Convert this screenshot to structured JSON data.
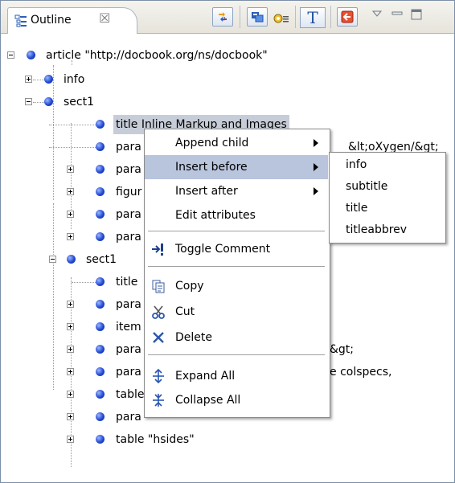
{
  "tab": {
    "title": "Outline",
    "close_glyph": "☒"
  },
  "toolbar": {
    "t_button": "T"
  },
  "tree": [
    {
      "label": "article \"http://docbook.org/ns/docbook\"",
      "expanded": true
    },
    {
      "label": "info"
    },
    {
      "label": "sect1"
    },
    {
      "label": "title  Inline Markup and Images"
    },
    {
      "label": "para",
      "tail": "&lt;oXygen/&gt;"
    },
    {
      "label": "para"
    },
    {
      "label": "figur"
    },
    {
      "label": "para"
    },
    {
      "label": "para"
    },
    {
      "label": "sect1"
    },
    {
      "label": "title"
    },
    {
      "label": "para"
    },
    {
      "label": "item"
    },
    {
      "label": "para",
      "tail": "&gt;"
    },
    {
      "label": "para",
      "tail": "e colspecs,"
    },
    {
      "label": "table"
    },
    {
      "label": "para"
    },
    {
      "label": "table  \"hsides\""
    }
  ],
  "context_menu": {
    "items": [
      {
        "label": "Append child",
        "submenu": true
      },
      {
        "label": "Insert before",
        "submenu": true
      },
      {
        "label": "Insert after",
        "submenu": true
      },
      {
        "label": "Edit attributes"
      },
      {
        "label": "Toggle Comment",
        "icon": "toggle-comment-icon"
      },
      {
        "label": "Copy",
        "icon": "copy-icon"
      },
      {
        "label": "Cut",
        "icon": "cut-icon"
      },
      {
        "label": "Delete",
        "icon": "delete-icon"
      },
      {
        "label": "Expand All",
        "icon": "expand-all-icon"
      },
      {
        "label": "Collapse All",
        "icon": "collapse-all-icon"
      }
    ]
  },
  "submenu": {
    "items": [
      "info",
      "subtitle",
      "title",
      "titleabbrev"
    ]
  }
}
